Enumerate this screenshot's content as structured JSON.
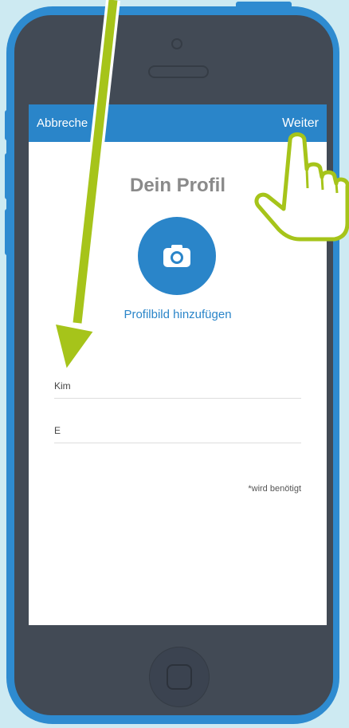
{
  "nav": {
    "cancel_label": "Abbreche",
    "next_label": "Weiter"
  },
  "profile": {
    "title": "Dein Profil",
    "add_photo_label": "Profilbild hinzufügen"
  },
  "form": {
    "first_name_value": "Kim",
    "last_name_value": "E",
    "required_note": "*wird benötigt"
  },
  "colors": {
    "accent": "#2a85c9",
    "phone_frame": "#2e8bd0",
    "phone_body": "#424a55",
    "background": "#cdeaf2",
    "tutorial_arrow": "#a6c41a"
  },
  "icons": {
    "avatar": "camera-icon",
    "tutorial_arrow": "arrow-down-icon",
    "tutorial_hand": "pointing-hand-icon"
  }
}
